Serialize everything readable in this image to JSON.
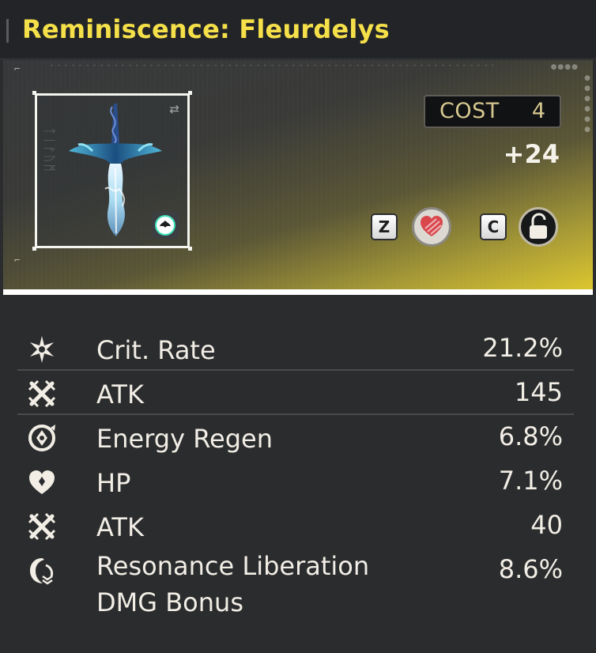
{
  "header": {
    "title": "Reminiscence: Fleurdelys"
  },
  "item": {
    "cost_label": "COST",
    "cost_value": "4",
    "level": "+24",
    "side_text": "ᛏᛁᚠᚢᛗ",
    "keys": {
      "compare_key": "Z",
      "lock_key": "C"
    },
    "colors": {
      "title": "#f5e04a",
      "hero_accent": "#dcc62e",
      "badge_ring": "#3de0b8",
      "heart": "#d9474d"
    }
  },
  "stats": [
    {
      "icon": "crit-rate-icon",
      "name": "Crit. Rate",
      "value": "21.2%"
    },
    {
      "icon": "atk-icon",
      "name": "ATK",
      "value": "145"
    },
    {
      "icon": "energy-regen-icon",
      "name": "Energy Regen",
      "value": "6.8%"
    },
    {
      "icon": "hp-icon",
      "name": "HP",
      "value": "7.1%"
    },
    {
      "icon": "atk-icon",
      "name": "ATK",
      "value": "40"
    },
    {
      "icon": "resonance-liberation-icon",
      "name": "Resonance Liberation DMG Bonus",
      "value": "8.6%"
    }
  ]
}
